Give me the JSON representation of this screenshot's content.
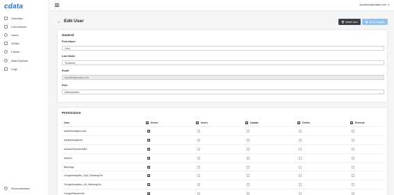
{
  "app": {
    "logo_text": "cdata",
    "brand_color": "#1a6fd6"
  },
  "sidebar": {
    "items": [
      {
        "label": "Overview",
        "icon": "home-icon"
      },
      {
        "label": "Connections",
        "icon": "link-icon"
      },
      {
        "label": "Users",
        "icon": "user-icon"
      },
      {
        "label": "OData",
        "icon": "odata-icon"
      },
      {
        "label": "Clients",
        "icon": "clients-icon"
      },
      {
        "label": "Data Explorer",
        "icon": "explorer-icon"
      },
      {
        "label": "Logs",
        "icon": "logs-icon"
      }
    ],
    "bottom": {
      "label": "Documentation",
      "icon": "docs-icon"
    }
  },
  "topbar": {
    "user_email": "tsushima@cdata.com"
  },
  "header": {
    "title": "Edit User",
    "delete_label": "Delete User",
    "save_label": "Save Changes"
  },
  "general": {
    "title": "General",
    "first_name_label": "First Name",
    "first_name_value": "Yoko",
    "last_name_label": "Last Name",
    "last_name_value": "Tsushima",
    "email_label": "Email",
    "email_value": "tsushima@cdata.com",
    "role_label": "Role",
    "role_value": "Administrator"
  },
  "permissions": {
    "title": "Permissions",
    "headers": {
      "user": "User",
      "select": "Select",
      "insert": "Insert",
      "update": "Update",
      "delete": "Delete",
      "execute": "Execute"
    },
    "rows": [
      {
        "name": "AdobeAnalytics-test",
        "select": true,
        "insert": false,
        "update": false,
        "delete": false,
        "execute": false
      },
      {
        "name": "AdobeAnalytics0",
        "select": true,
        "insert": false,
        "update": false,
        "delete": false,
        "execute": false
      },
      {
        "name": "AmazonDynamoDB1",
        "select": true,
        "insert": false,
        "update": false,
        "delete": false,
        "execute": false
      },
      {
        "name": "Asana1",
        "select": true,
        "insert": false,
        "update": false,
        "delete": false,
        "execute": false
      },
      {
        "name": "Backlog1",
        "select": true,
        "insert": false,
        "update": false,
        "delete": false,
        "execute": false
      },
      {
        "name": "GoogleAnalytics_GA4_WorkingGin",
        "select": true,
        "insert": false,
        "update": false,
        "delete": false,
        "execute": false
      },
      {
        "name": "GoogleAnalytics_UA_WorkingGin",
        "select": true,
        "insert": false,
        "update": false,
        "delete": false,
        "execute": false
      },
      {
        "name": "GoogleSheetsTest",
        "select": true,
        "insert": false,
        "update": false,
        "delete": false,
        "execute": false
      }
    ]
  }
}
